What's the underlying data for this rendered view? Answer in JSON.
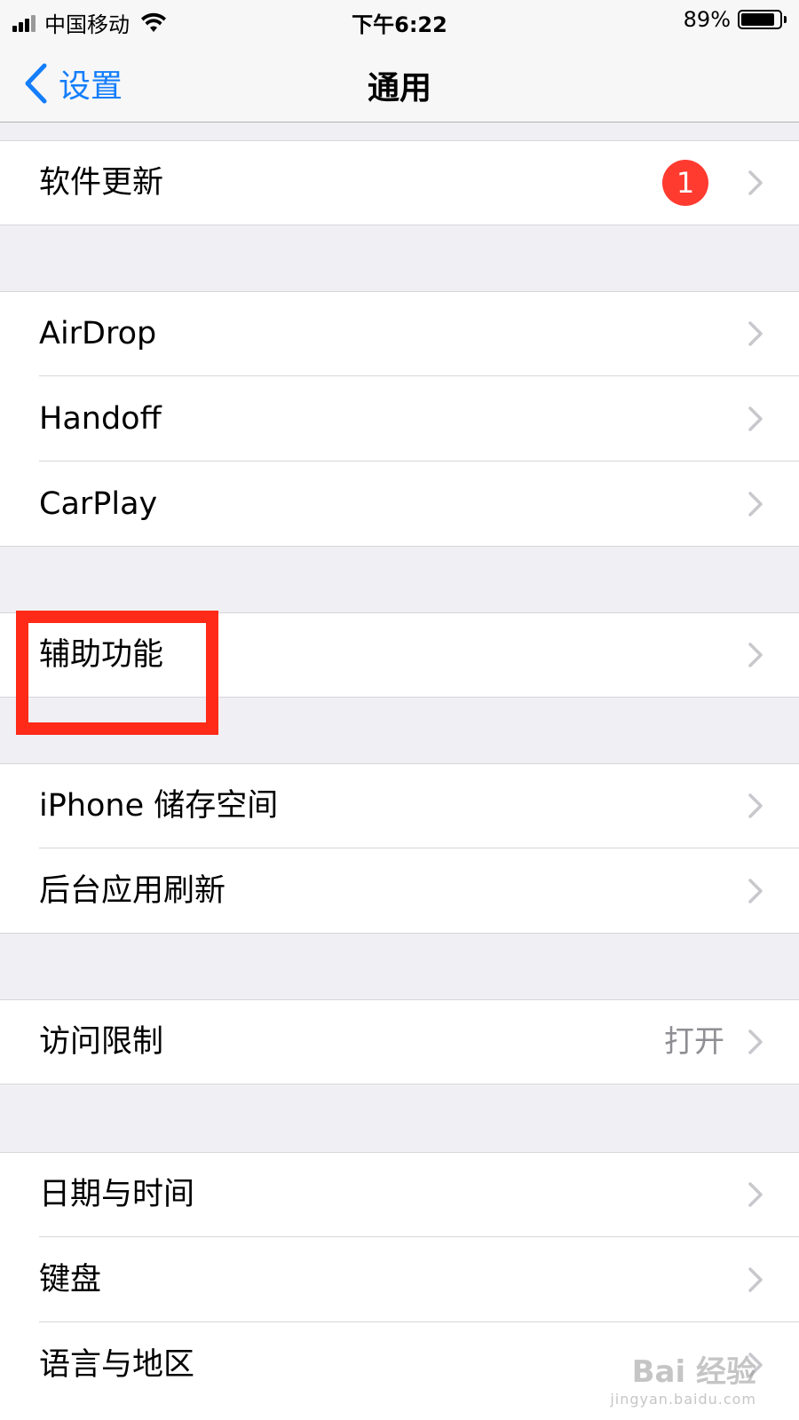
{
  "status_bar": {
    "carrier": "中国移动",
    "time": "下午6:22",
    "battery": "89%",
    "battery_level": 0.89
  },
  "nav": {
    "back_label": "设置",
    "title": "通用"
  },
  "sections": [
    {
      "rows": [
        {
          "label": "软件更新",
          "badge": "1"
        }
      ]
    },
    {
      "rows": [
        {
          "label": "AirDrop"
        },
        {
          "label": "Handoff"
        },
        {
          "label": "CarPlay"
        }
      ]
    },
    {
      "rows": [
        {
          "label": "辅助功能"
        }
      ]
    },
    {
      "rows": [
        {
          "label": "iPhone 储存空间"
        },
        {
          "label": "后台应用刷新"
        }
      ]
    },
    {
      "rows": [
        {
          "label": "访问限制",
          "detail": "打开"
        }
      ]
    },
    {
      "rows": [
        {
          "label": "日期与时间"
        },
        {
          "label": "键盘"
        },
        {
          "label": "语言与地区"
        }
      ]
    }
  ],
  "watermark": {
    "main": "Bai 经验",
    "sub": "jingyan.baidu.com"
  },
  "colors": {
    "accent": "#147efb",
    "badge": "#ff3b30",
    "highlight": "#ff2a17",
    "group_bg": "#efeff4"
  }
}
